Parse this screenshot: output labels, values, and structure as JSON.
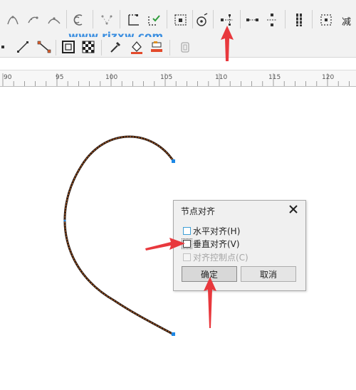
{
  "watermark": {
    "text": "www.rjzxw.com"
  },
  "toolbar_row1": {
    "labels": {
      "reduce_nodes": "减"
    },
    "icons": [
      "stretch-node-icon",
      "skew-node-icon",
      "reflect-node-icon",
      "reverse-direction-icon",
      "node-branch-icon",
      "close-curve-icon",
      "extract-subpath-icon",
      "select-all-nodes-icon",
      "elastic-mode-icon",
      "align-nodes-icon",
      "align-horizontal-icon",
      "align-vertical-icon",
      "distribute-nodes-icon",
      "reduce-nodes-icon"
    ]
  },
  "toolbar_row2": {
    "icons": [
      "node-type-icon",
      "line-tool-icon",
      "smart-line-icon",
      "frame-icon",
      "checker-fill-icon",
      "eyedropper-icon",
      "fill-bucket-icon",
      "paint-tool-icon",
      "lock-icon"
    ]
  },
  "ruler": {
    "ticks": [
      "90",
      "95",
      "100",
      "105",
      "110",
      "115",
      "120"
    ]
  },
  "dialog": {
    "title": "节点对齐",
    "options": [
      {
        "label": "水平对齐(H)",
        "checked": false,
        "enabled": true
      },
      {
        "label": "垂直对齐(V)",
        "checked": false,
        "enabled": true
      },
      {
        "label": "对齐控制点(C)",
        "checked": false,
        "enabled": false
      }
    ],
    "ok_label": "确定",
    "cancel_label": "取消"
  },
  "colors": {
    "annotation_arrow": "#e8383d",
    "node_handle": "#1e88e5",
    "curve": "#2b1a12",
    "curve_highlight": "#e0762a"
  }
}
